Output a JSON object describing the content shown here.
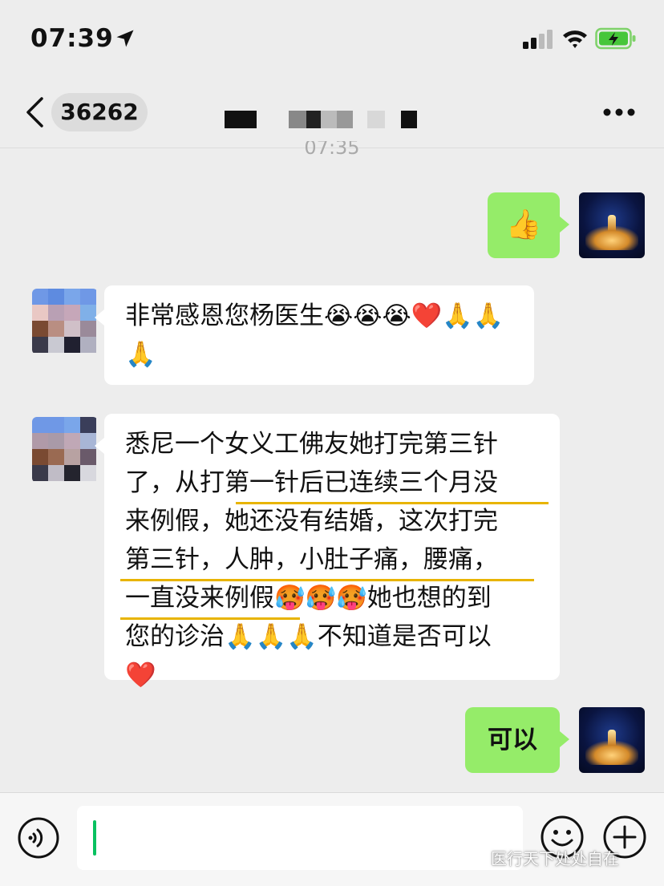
{
  "status_bar": {
    "time": "07:39"
  },
  "nav": {
    "chat_count": "36262"
  },
  "timestamp": "07:35",
  "messages": {
    "m1": {
      "sender": "me",
      "text": "👍"
    },
    "m2": {
      "sender": "contact",
      "text": "非常感恩您杨医生😭😭😭❤️🙏🙏🙏"
    },
    "m3": {
      "sender": "contact",
      "lines": [
        "悉尼一个女义工佛友她打完第三针",
        "了，从打第一针后已连续三个月没",
        "来例假，她还没有结婚，这次打完",
        "第三针，人肿，小肚子痛，腰痛，",
        "一直没来例假🥵🥵🥵她也想的到",
        "您的诊治🙏🙏🙏不知道是否可以",
        "❤️"
      ]
    },
    "m4": {
      "sender": "me",
      "text": "可以"
    }
  },
  "input": {
    "value": ""
  },
  "watermark": "医行天下处处自在",
  "colors": {
    "bubble_me": "#95ec69",
    "bubble_other": "#ffffff",
    "background": "#ededed",
    "caret": "#07c160",
    "underline": "#e8b400"
  }
}
